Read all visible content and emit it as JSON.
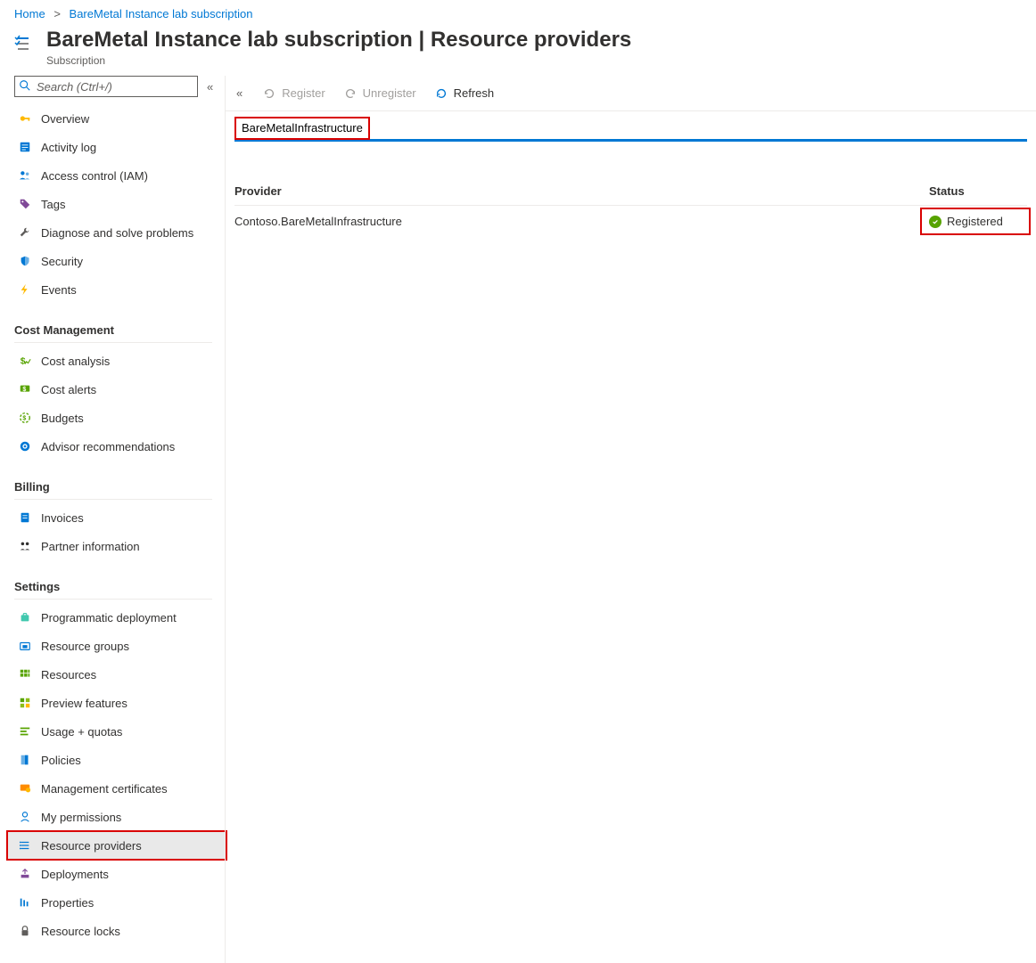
{
  "breadcrumb": {
    "home": "Home",
    "current": "BareMetal Instance lab subscription"
  },
  "header": {
    "title": "BareMetal Instance lab subscription | Resource providers",
    "subtitle": "Subscription"
  },
  "sidebar": {
    "search_placeholder": "Search (Ctrl+/)",
    "top": [
      {
        "label": "Overview",
        "icon": "key"
      },
      {
        "label": "Activity log",
        "icon": "log"
      },
      {
        "label": "Access control (IAM)",
        "icon": "people"
      },
      {
        "label": "Tags",
        "icon": "tag"
      },
      {
        "label": "Diagnose and solve problems",
        "icon": "wrench"
      },
      {
        "label": "Security",
        "icon": "shield"
      },
      {
        "label": "Events",
        "icon": "bolt"
      }
    ],
    "groups": [
      {
        "title": "Cost Management",
        "items": [
          {
            "label": "Cost analysis",
            "icon": "cost"
          },
          {
            "label": "Cost alerts",
            "icon": "costalert"
          },
          {
            "label": "Budgets",
            "icon": "budget"
          },
          {
            "label": "Advisor recommendations",
            "icon": "advisor"
          }
        ]
      },
      {
        "title": "Billing",
        "items": [
          {
            "label": "Invoices",
            "icon": "invoice"
          },
          {
            "label": "Partner information",
            "icon": "partner"
          }
        ]
      },
      {
        "title": "Settings",
        "items": [
          {
            "label": "Programmatic deployment",
            "icon": "bag"
          },
          {
            "label": "Resource groups",
            "icon": "rg"
          },
          {
            "label": "Resources",
            "icon": "grid"
          },
          {
            "label": "Preview features",
            "icon": "preview"
          },
          {
            "label": "Usage + quotas",
            "icon": "usage"
          },
          {
            "label": "Policies",
            "icon": "policy"
          },
          {
            "label": "Management certificates",
            "icon": "cert"
          },
          {
            "label": "My permissions",
            "icon": "person"
          },
          {
            "label": "Resource providers",
            "icon": "providers",
            "selected": true
          },
          {
            "label": "Deployments",
            "icon": "deploy"
          },
          {
            "label": "Properties",
            "icon": "props"
          },
          {
            "label": "Resource locks",
            "icon": "lock"
          }
        ]
      }
    ]
  },
  "toolbar": {
    "register": "Register",
    "unregister": "Unregister",
    "refresh": "Refresh"
  },
  "filter": {
    "value": "BareMetalInfrastructure"
  },
  "table": {
    "headers": {
      "provider": "Provider",
      "status": "Status"
    },
    "rows": [
      {
        "provider": "Contoso.BareMetalInfrastructure",
        "status": "Registered"
      }
    ]
  },
  "colors": {
    "link": "#0078d4",
    "highlight": "#d90000",
    "success": "#57a300"
  }
}
